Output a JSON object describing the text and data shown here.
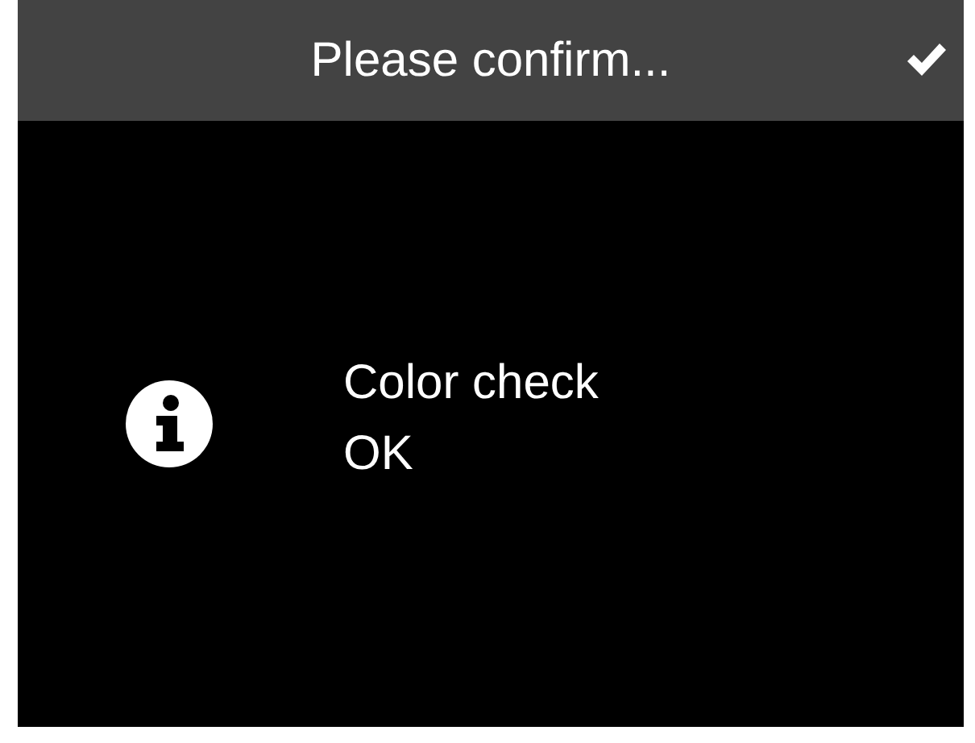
{
  "dialog": {
    "title": "Please confirm...",
    "kind": "info",
    "message_lines": [
      "Color check",
      "OK"
    ]
  }
}
